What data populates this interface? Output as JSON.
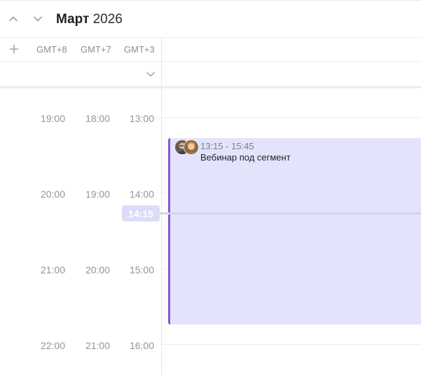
{
  "header": {
    "month": "Март",
    "year": "2026"
  },
  "timezones": [
    "GMT+8",
    "GMT+7",
    "GMT+3"
  ],
  "time_rows": [
    {
      "tz1": "19:00",
      "tz2": "18:00",
      "tz3": "13:00"
    },
    {
      "tz1": "20:00",
      "tz2": "19:00",
      "tz3": "14:00"
    },
    {
      "tz1": "21:00",
      "tz2": "20:00",
      "tz3": "15:00"
    },
    {
      "tz1": "22:00",
      "tz2": "21:00",
      "tz3": "16:00"
    }
  ],
  "now": {
    "label": "14:15"
  },
  "event": {
    "time": "13:15 - 15:45",
    "title": "Вебинар под сегмент"
  },
  "colors": {
    "event_bg": "#e3e4fc",
    "event_accent": "#8a58c9",
    "now_indicator": "#d3d3f6",
    "time_text": "#94949b"
  },
  "icons": [
    "chevron-up-icon",
    "chevron-down-icon",
    "plus-icon",
    "collapse-chevron-icon",
    "avatar"
  ]
}
